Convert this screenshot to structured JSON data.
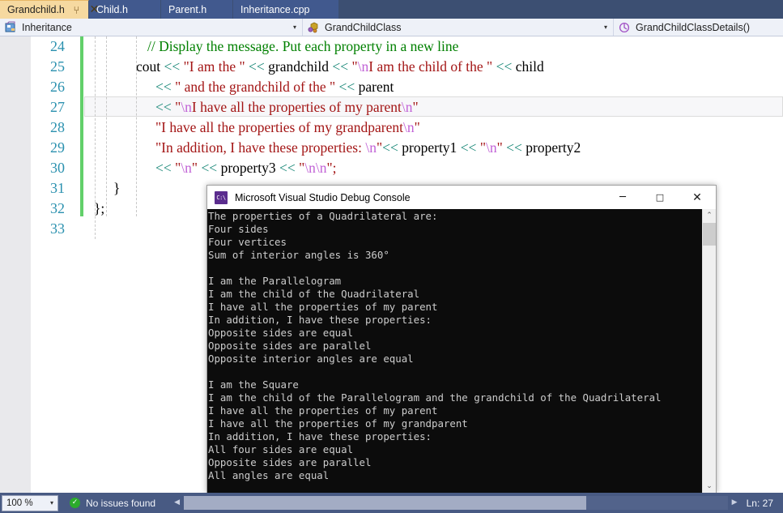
{
  "tabs": [
    {
      "label": "Grandchild.h",
      "active": true,
      "pin_icon": "pin-icon",
      "close_icon": "close-icon"
    },
    {
      "label": "Child.h",
      "active": false
    },
    {
      "label": "Parent.h",
      "active": false
    },
    {
      "label": "Inheritance.cpp",
      "active": false
    }
  ],
  "nav_bar": {
    "project": {
      "icon": "project-icon",
      "value": "Inheritance",
      "arrow": "▾"
    },
    "class": {
      "icon": "class-icon",
      "value": "GrandChildClass",
      "arrow": "▾"
    },
    "member": {
      "icon": "method-icon",
      "value": "GrandChildClassDetails()"
    }
  },
  "editor": {
    "first_line": 24,
    "lines": [
      {
        "num": "24",
        "indent": 72,
        "tokens": [
          {
            "t": "// Display the message. Put each property in a new line",
            "c": "cm"
          }
        ]
      },
      {
        "num": "25",
        "indent": 58,
        "tokens": [
          {
            "t": "cout ",
            "c": "pl"
          },
          {
            "t": "<< ",
            "c": "op"
          },
          {
            "t": "\"I am the \" ",
            "c": "str"
          },
          {
            "t": "<< ",
            "c": "op"
          },
          {
            "t": "grandchild ",
            "c": "pl"
          },
          {
            "t": "<< ",
            "c": "op"
          },
          {
            "t": "\"",
            "c": "str"
          },
          {
            "t": "\\n",
            "c": "esc"
          },
          {
            "t": "I am the child of the \" ",
            "c": "str"
          },
          {
            "t": "<< ",
            "c": "op"
          },
          {
            "t": "child",
            "c": "pl"
          }
        ]
      },
      {
        "num": "26",
        "indent": 82,
        "tokens": [
          {
            "t": "<< ",
            "c": "op"
          },
          {
            "t": "\" and the grandchild of the \" ",
            "c": "str"
          },
          {
            "t": "<< ",
            "c": "op"
          },
          {
            "t": "parent",
            "c": "pl"
          }
        ]
      },
      {
        "num": "27",
        "indent": 82,
        "tokens": [
          {
            "t": "<< ",
            "c": "op"
          },
          {
            "t": "\"",
            "c": "str"
          },
          {
            "t": "\\n",
            "c": "esc"
          },
          {
            "t": "I have all the properties of my parent",
            "c": "str"
          },
          {
            "t": "\\n",
            "c": "esc"
          },
          {
            "t": "\"",
            "c": "str"
          }
        ]
      },
      {
        "num": "28",
        "indent": 82,
        "tokens": [
          {
            "t": "\"I have all the properties of my grandparent",
            "c": "str"
          },
          {
            "t": "\\n",
            "c": "esc"
          },
          {
            "t": "\"",
            "c": "str"
          }
        ]
      },
      {
        "num": "29",
        "indent": 82,
        "tokens": [
          {
            "t": "\"In addition, I have these properties: ",
            "c": "str"
          },
          {
            "t": "\\n",
            "c": "esc"
          },
          {
            "t": "\"",
            "c": "str"
          },
          {
            "t": "<< ",
            "c": "op"
          },
          {
            "t": "property1 ",
            "c": "pl"
          },
          {
            "t": "<< ",
            "c": "op"
          },
          {
            "t": "\"",
            "c": "str"
          },
          {
            "t": "\\n",
            "c": "esc"
          },
          {
            "t": "\" ",
            "c": "str"
          },
          {
            "t": "<< ",
            "c": "op"
          },
          {
            "t": "property2",
            "c": "pl"
          }
        ]
      },
      {
        "num": "30",
        "indent": 82,
        "tokens": [
          {
            "t": "<< ",
            "c": "op"
          },
          {
            "t": "\"",
            "c": "str"
          },
          {
            "t": "\\n",
            "c": "esc"
          },
          {
            "t": "\" ",
            "c": "str"
          },
          {
            "t": "<< ",
            "c": "op"
          },
          {
            "t": "property3 ",
            "c": "pl"
          },
          {
            "t": "<< ",
            "c": "op"
          },
          {
            "t": "\"",
            "c": "str"
          },
          {
            "t": "\\n\\n",
            "c": "esc"
          },
          {
            "t": "\";",
            "c": "str"
          }
        ]
      },
      {
        "num": "31",
        "indent": 30,
        "tokens": [
          {
            "t": "}",
            "c": "pl"
          }
        ]
      },
      {
        "num": "32",
        "indent": 6,
        "tokens": [
          {
            "t": "};",
            "c": "pl"
          }
        ]
      },
      {
        "num": "33",
        "indent": 6,
        "tokens": []
      }
    ]
  },
  "console": {
    "title": "Microsoft Visual Studio Debug Console",
    "app_icon": "console-icon",
    "window_buttons": {
      "minimize": {
        "glyph": "─",
        "name": "minimize-button"
      },
      "maximize": {
        "glyph": "□",
        "name": "maximize-button"
      },
      "close": {
        "glyph": "✕",
        "name": "close-button"
      }
    },
    "output": "The properties of a Quadrilateral are:\nFour sides\nFour vertices\nSum of interior angles is 360°\n\nI am the Parallelogram\nI am the child of the Quadrilateral\nI have all the properties of my parent\nIn addition, I have these properties:\nOpposite sides are equal\nOpposite sides are parallel\nOpposite interior angles are equal\n\nI am the Square\nI am the child of the Parallelogram and the grandchild of the Quadrilateral\nI have all the properties of my parent\nI have all the properties of my grandparent\nIn addition, I have these properties:\nAll four sides are equal\nOpposite sides are parallel\nAll angles are equal",
    "scrollbar": {
      "up_glyph": "⌃",
      "down_glyph": "⌄"
    }
  },
  "status_bar": {
    "zoom": {
      "value": "100 %",
      "arrow": "▾"
    },
    "issues": {
      "icon": "check-circle-icon",
      "glyph": "✓",
      "text": "No issues found"
    },
    "hscroll": {
      "left_glyph": "◀",
      "right_glyph": "▶"
    },
    "line_indicator": "Ln: 27"
  },
  "colors": {
    "tab_active_bg": "#f6d9a0",
    "tab_inactive_bg": "#41598e",
    "chrome_bg": "#3c4f72",
    "status_bar_bg": "#485a83",
    "line_number": "#2b91af",
    "comment": "#008000",
    "string": "#a31515",
    "escape": "#c162d6",
    "operator": "#1d8a7a",
    "change_bar": "#62d06a",
    "console_bg": "#0c0c0c",
    "console_fg": "#cccccc",
    "ok_green": "#2cab2c"
  }
}
